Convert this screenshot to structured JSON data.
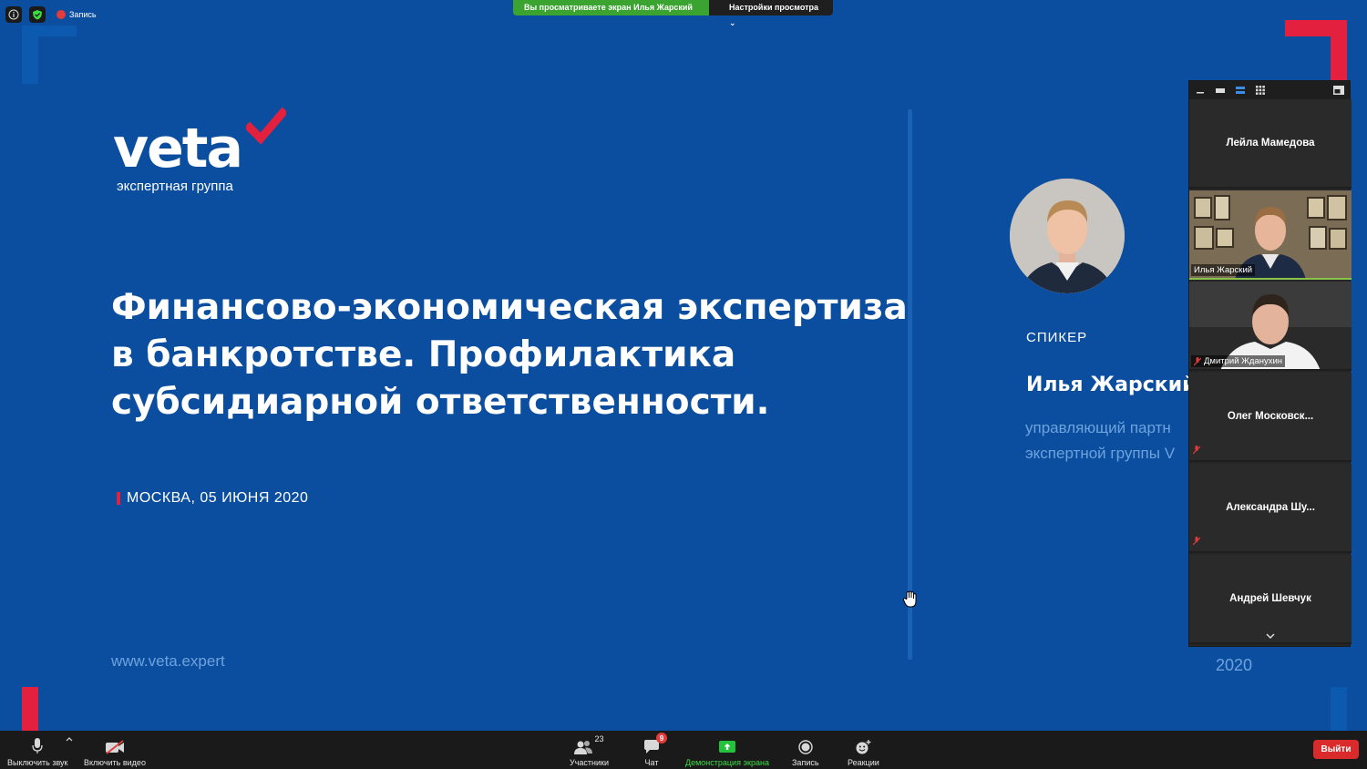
{
  "top_bar": {
    "recording_label": "Запись",
    "viewing_banner": "Вы просматриваете экран Илья Жарский",
    "view_options_label": "Настройки просмотра"
  },
  "slide": {
    "logo_word": "veta",
    "logo_tagline": "экспертная группа",
    "title_lines": [
      "Финансово-экономическая экспертиза",
      "в банкротстве. Профилактика",
      "субсидиарной ответственности."
    ],
    "date_text": "МОСКВА, 05 ИЮНЯ 2020",
    "website": "www.veta.expert",
    "speaker_label": "СПИКЕР",
    "speaker_name": "Илья Жарский",
    "speaker_role_lines": [
      "управляющий партн",
      "экспертной группы V"
    ],
    "year": "2020",
    "accent_color": "#e3213f",
    "background_color": "#0b4e9f"
  },
  "participants": [
    {
      "name": "Лейла Мамедова",
      "video": false,
      "muted": false
    },
    {
      "name": "Илья Жарский",
      "video": true,
      "muted": false,
      "active": true
    },
    {
      "name": "Дмитрий Жданухин",
      "video": true,
      "muted": true
    },
    {
      "name": "Олег  Московск...",
      "video": false,
      "muted": true
    },
    {
      "name": "Александра  Шу...",
      "video": false,
      "muted": true
    },
    {
      "name": "Андрей Шевчук",
      "video": false,
      "muted": false
    }
  ],
  "toolbar": {
    "mute_label": "Выключить звук",
    "video_label": "Включить видео",
    "participants_label": "Участники",
    "participants_count": "23",
    "chat_label": "Чат",
    "chat_badge": "9",
    "share_label": "Демонстрация экрана",
    "record_label": "Запись",
    "reactions_label": "Реакции",
    "leave_label": "Выйти"
  }
}
